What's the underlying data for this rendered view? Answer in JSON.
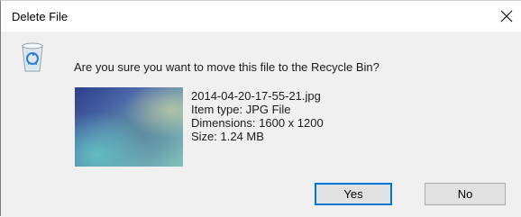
{
  "dialog": {
    "title": "Delete File",
    "question": "Are you sure you want to move this file to the Recycle Bin?",
    "icon": "recycle-bin-icon",
    "file": {
      "name": "2014-04-20-17-55-21.jpg",
      "type": "Item type: JPG File",
      "dimensions": "Dimensions: 1600 x 1200",
      "size": "Size: 1.24 MB"
    },
    "buttons": {
      "yes": "Yes",
      "no": "No"
    }
  }
}
